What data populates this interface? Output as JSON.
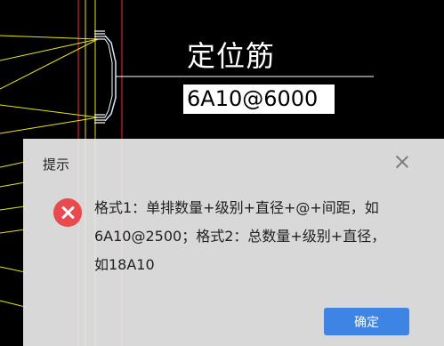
{
  "cad": {
    "title_text": "定位筋",
    "input_value": "6A10@6000"
  },
  "dialog": {
    "title": "提示",
    "icon": "error-x-icon",
    "message": "格式1：单排数量+级别+直径+@+间距，如6A10@2500；格式2：总数量+级别+直径，如18A10",
    "ok_label": "确定",
    "colors": {
      "error": "#ea4a4d",
      "button": "#3d84e5"
    }
  },
  "colors": {
    "background": "#000000",
    "yellow_lines": "#ffff00",
    "red_lines": "#ff2020",
    "white": "#ffffff"
  }
}
